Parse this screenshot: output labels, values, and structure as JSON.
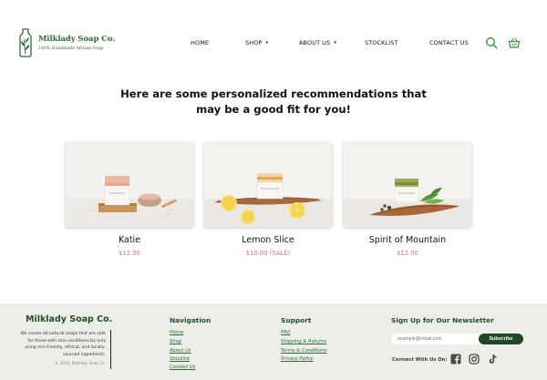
{
  "header": {
    "logo_name": "Milklady Soap Co.",
    "logo_tagline": "100% Handmade Artisan Soap",
    "nav": [
      {
        "label": "HOME",
        "has_caret": false
      },
      {
        "label": "SHOP",
        "has_caret": true
      },
      {
        "label": "ABOUT US",
        "has_caret": true
      },
      {
        "label": "STOCKLIST",
        "has_caret": false
      },
      {
        "label": "CONTACT US",
        "has_caret": false
      }
    ],
    "caret_icon": "▾",
    "search_icon": "search-icon",
    "cart_icon": "basket-icon"
  },
  "main": {
    "headline_line1": "Here are some personalized recommendations that",
    "headline_line2": "may be a good fit for you!",
    "products": [
      {
        "name": "Katie",
        "price": "$12.00"
      },
      {
        "name": "Lemon Slice",
        "price": "$10.00 (SALE)"
      },
      {
        "name": "Spirit of Mountain",
        "price": "$12.00"
      }
    ]
  },
  "footer": {
    "brand": "Milklady Soap Co.",
    "description": "We create all-natural soaps that are safe for those with skin conditions by only using eco-friendly, ethical, and locally-sourced ingredients.",
    "copyright": "© 2022, Milklady Soap Co.",
    "navigation": {
      "title": "Navigation",
      "links": [
        "Home",
        "Shop",
        "About Us",
        "Stocklist",
        "Contact Us"
      ]
    },
    "support": {
      "title": "Support",
      "links": [
        "FAQ",
        "Shipping & Returns",
        "Terms & Conditions",
        "Privacy Policy"
      ]
    },
    "newsletter": {
      "title": "Sign Up for Our Newsletter",
      "placeholder": "example@email.com",
      "button": "Subscribe",
      "connect": "Connect With Us On:",
      "socials": [
        "facebook-icon",
        "instagram-icon",
        "tiktok-icon"
      ]
    }
  },
  "colors": {
    "brand_green": "#2e6b33",
    "dark_green": "#1f4a24",
    "price": "#c27a70",
    "footer_bg": "#edeeea"
  }
}
